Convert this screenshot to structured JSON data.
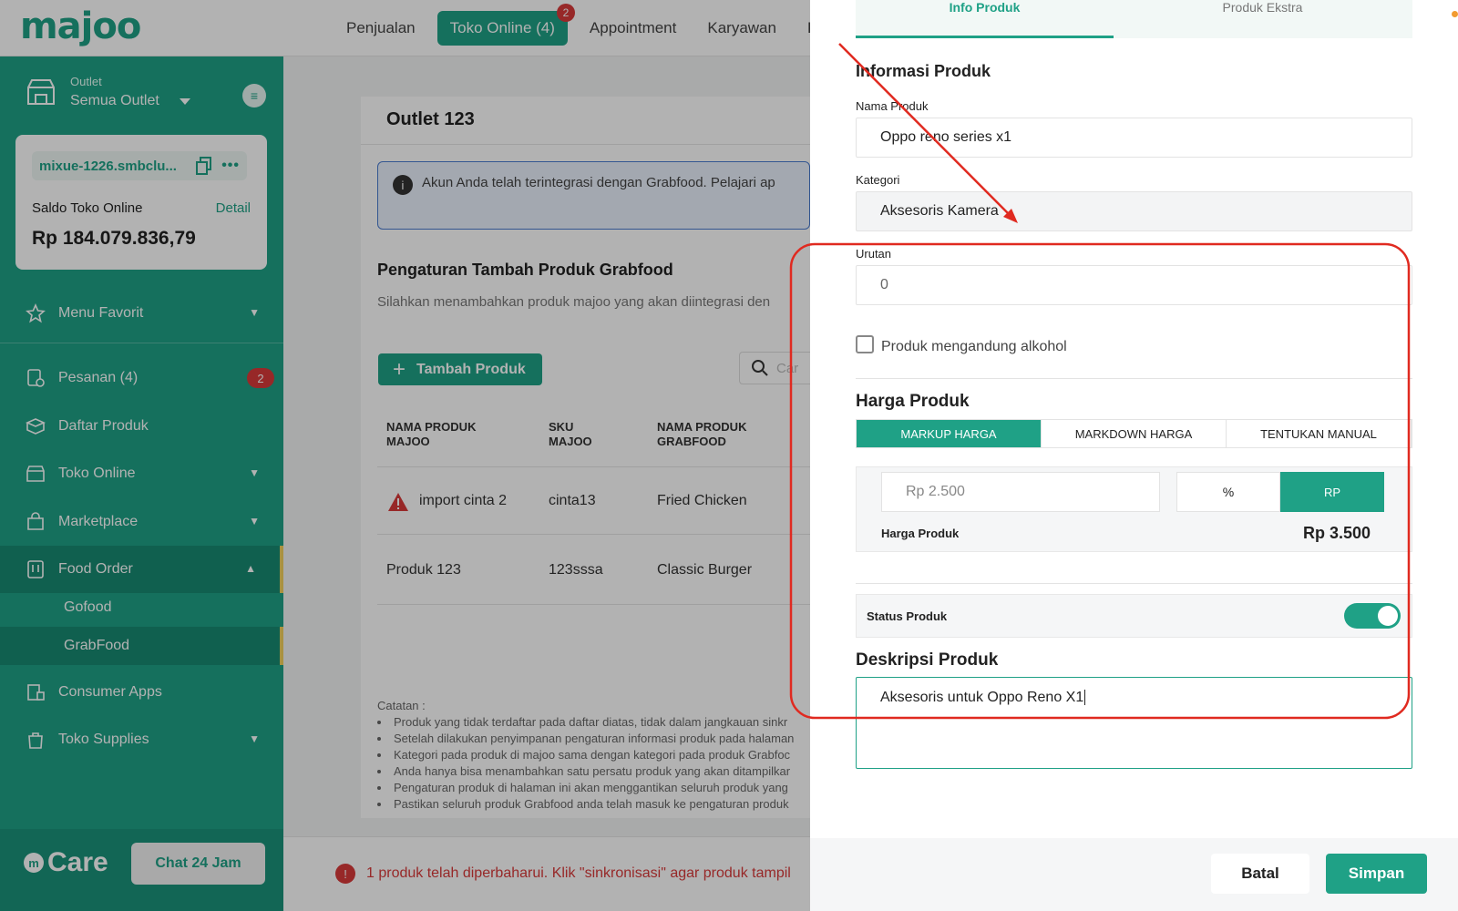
{
  "app": {
    "logo": "majoo"
  },
  "topnav": {
    "items": [
      {
        "label": "Penjualan"
      },
      {
        "label": "Toko Online (4)",
        "badge": "2"
      },
      {
        "label": "Appointment"
      },
      {
        "label": "Karyawan"
      },
      {
        "label": "K"
      }
    ]
  },
  "sidebar": {
    "outlet_label": "Outlet",
    "outlet_value": "Semua Outlet",
    "store_url": "mixue-1226.smbclu...",
    "saldo_label": "Saldo Toko Online",
    "detail_link": "Detail",
    "saldo_value": "Rp 184.079.836,79",
    "items": [
      {
        "label": "Menu Favorit",
        "icon": "star-icon"
      },
      {
        "label": "Pesanan (4)",
        "icon": "order-icon",
        "badge": "2"
      },
      {
        "label": "Daftar Produk",
        "icon": "box-icon"
      },
      {
        "label": "Toko Online",
        "icon": "store-icon"
      },
      {
        "label": "Marketplace",
        "icon": "bag-icon"
      },
      {
        "label": "Food Order",
        "icon": "food-icon"
      },
      {
        "label": "Consumer Apps",
        "icon": "apps-icon"
      },
      {
        "label": "Toko Supplies",
        "icon": "supplies-icon"
      }
    ],
    "sub_items": [
      {
        "label": "Gofood"
      },
      {
        "label": "GrabFood"
      }
    ],
    "care_logo": "Care",
    "chat_button": "Chat 24 Jam"
  },
  "main": {
    "outlet_title": "Outlet 123",
    "info_text": "Akun Anda telah terintegrasi dengan Grabfood. Pelajari ap",
    "section_title": "Pengaturan Tambah Produk Grabfood",
    "section_subtitle": "Silahkan menambahkan produk majoo yang akan diintegrasi den",
    "add_button": "Tambah Produk",
    "search_placeholder": "Car",
    "table": {
      "headers": [
        {
          "line1": "NAMA PRODUK",
          "line2": "MAJOO"
        },
        {
          "line1": "SKU",
          "line2": "MAJOO"
        },
        {
          "line1": "NAMA PRODUK",
          "line2": "GRABFOOD"
        }
      ],
      "rows": [
        {
          "name": "import cinta 2",
          "sku": "cinta13",
          "grab": "Fried Chicken"
        },
        {
          "name": "Produk 123",
          "sku": "123sssa",
          "grab": "Classic Burger"
        }
      ]
    },
    "notes_title": "Catatan :",
    "notes": [
      "Produk yang tidak terdaftar pada daftar diatas, tidak dalam jangkauan sinkr",
      "Setelah dilakukan penyimpanan pengaturan informasi produk pada halaman",
      "Kategori pada produk di majoo sama dengan kategori pada produk Grabfoc",
      "Anda hanya bisa menambahkan satu persatu produk yang akan ditampilkar",
      "Pengaturan produk di halaman ini akan menggantikan seluruh produk yang",
      "Pastikan seluruh produk Grabfood anda telah masuk ke pengaturan produk"
    ],
    "error_text": "1 produk telah diperbaharui. Klik \"sinkronisasi\" agar produk tampil"
  },
  "drawer": {
    "tabs": [
      {
        "label": "Info Produk"
      },
      {
        "label": "Produk Ekstra"
      }
    ],
    "section_title": "Informasi Produk",
    "nama_label": "Nama Produk",
    "nama_value": "Oppo reno series x1",
    "kategori_label": "Kategori",
    "kategori_value": "Aksesoris Kamera",
    "urutan_label": "Urutan",
    "urutan_value": "0",
    "alkohol_label": "Produk mengandung alkohol",
    "harga_title": "Harga Produk",
    "harga_tabs": [
      {
        "label": "MARKUP HARGA"
      },
      {
        "label": "MARKDOWN HARGA"
      },
      {
        "label": "TENTUKAN MANUAL"
      }
    ],
    "markup_value": "Rp 2.500",
    "unit_pct": "%",
    "unit_rp": "RP",
    "harga_produk_label": "Harga Produk",
    "harga_produk_value": "Rp 3.500",
    "status_label": "Status Produk",
    "deskripsi_title": "Deskripsi Produk",
    "deskripsi_value": "Aksesoris untuk Oppo Reno X1",
    "batal_button": "Batal",
    "simpan_button": "Simpan"
  },
  "colors": {
    "brand": "#1fa186",
    "danger": "#d83a3a",
    "annotation": "#e02a20"
  }
}
